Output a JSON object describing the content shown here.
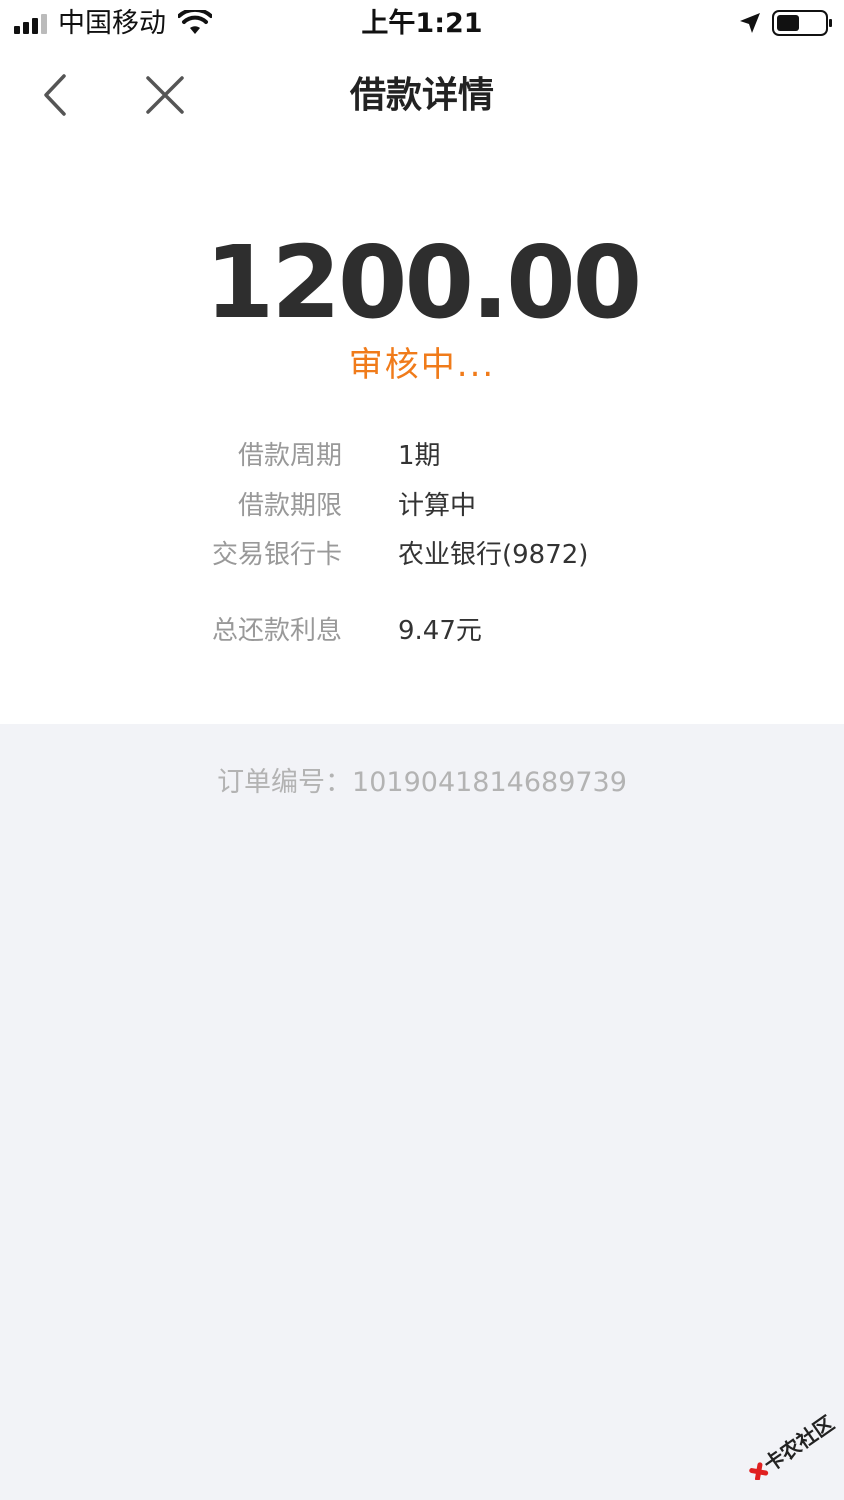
{
  "status_bar": {
    "carrier": "中国移动",
    "time": "上午1:21"
  },
  "nav": {
    "title": "借款详情"
  },
  "loan": {
    "amount": "1200.00",
    "status": "审核中...",
    "details": [
      {
        "label": "借款周期",
        "value": "1期"
      },
      {
        "label": "借款期限",
        "value": "计算中"
      },
      {
        "label": "交易银行卡",
        "value": "农业银行(9872)"
      },
      {
        "label": "总还款利息",
        "value": "9.47元"
      }
    ]
  },
  "order": {
    "text": "订单编号：1019041814689739"
  },
  "watermark": {
    "text": "卡农社区"
  },
  "colors": {
    "accent": "#f07b1a",
    "label_gray": "#999999",
    "page_bg": "#f2f3f7"
  }
}
